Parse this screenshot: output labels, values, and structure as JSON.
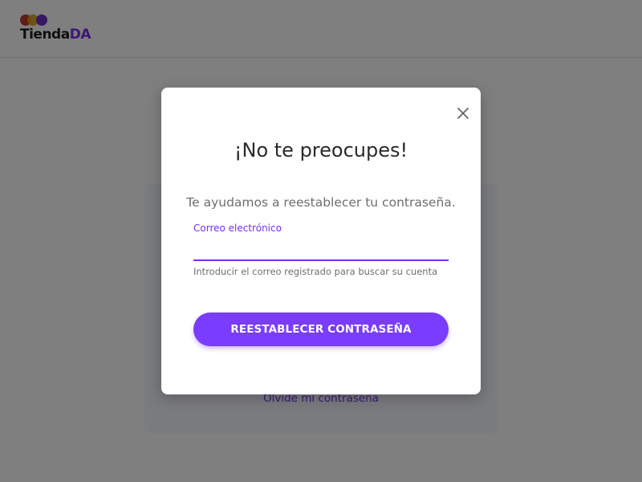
{
  "header": {
    "logo": {
      "text_main": "Tienda",
      "text_accent": "DA",
      "dot_colors": [
        "#c0392b",
        "#d4a017",
        "#6a2fc4"
      ]
    }
  },
  "background": {
    "forgot_password_link": "Olvidé mi contraseña"
  },
  "modal": {
    "title": "¡No te preocupes!",
    "subtitle": "Te ayudamos a reestablecer tu contraseña.",
    "email_field": {
      "label": "Correo electrónico",
      "value": "",
      "helper": "Introducir el correo registrado para buscar su cuenta"
    },
    "submit_label": "REESTABLECER CONTRASEÑA",
    "close_icon": "close-icon"
  },
  "colors": {
    "accent": "#7a3cff",
    "overlay": "rgba(0,0,0,0.5)"
  }
}
